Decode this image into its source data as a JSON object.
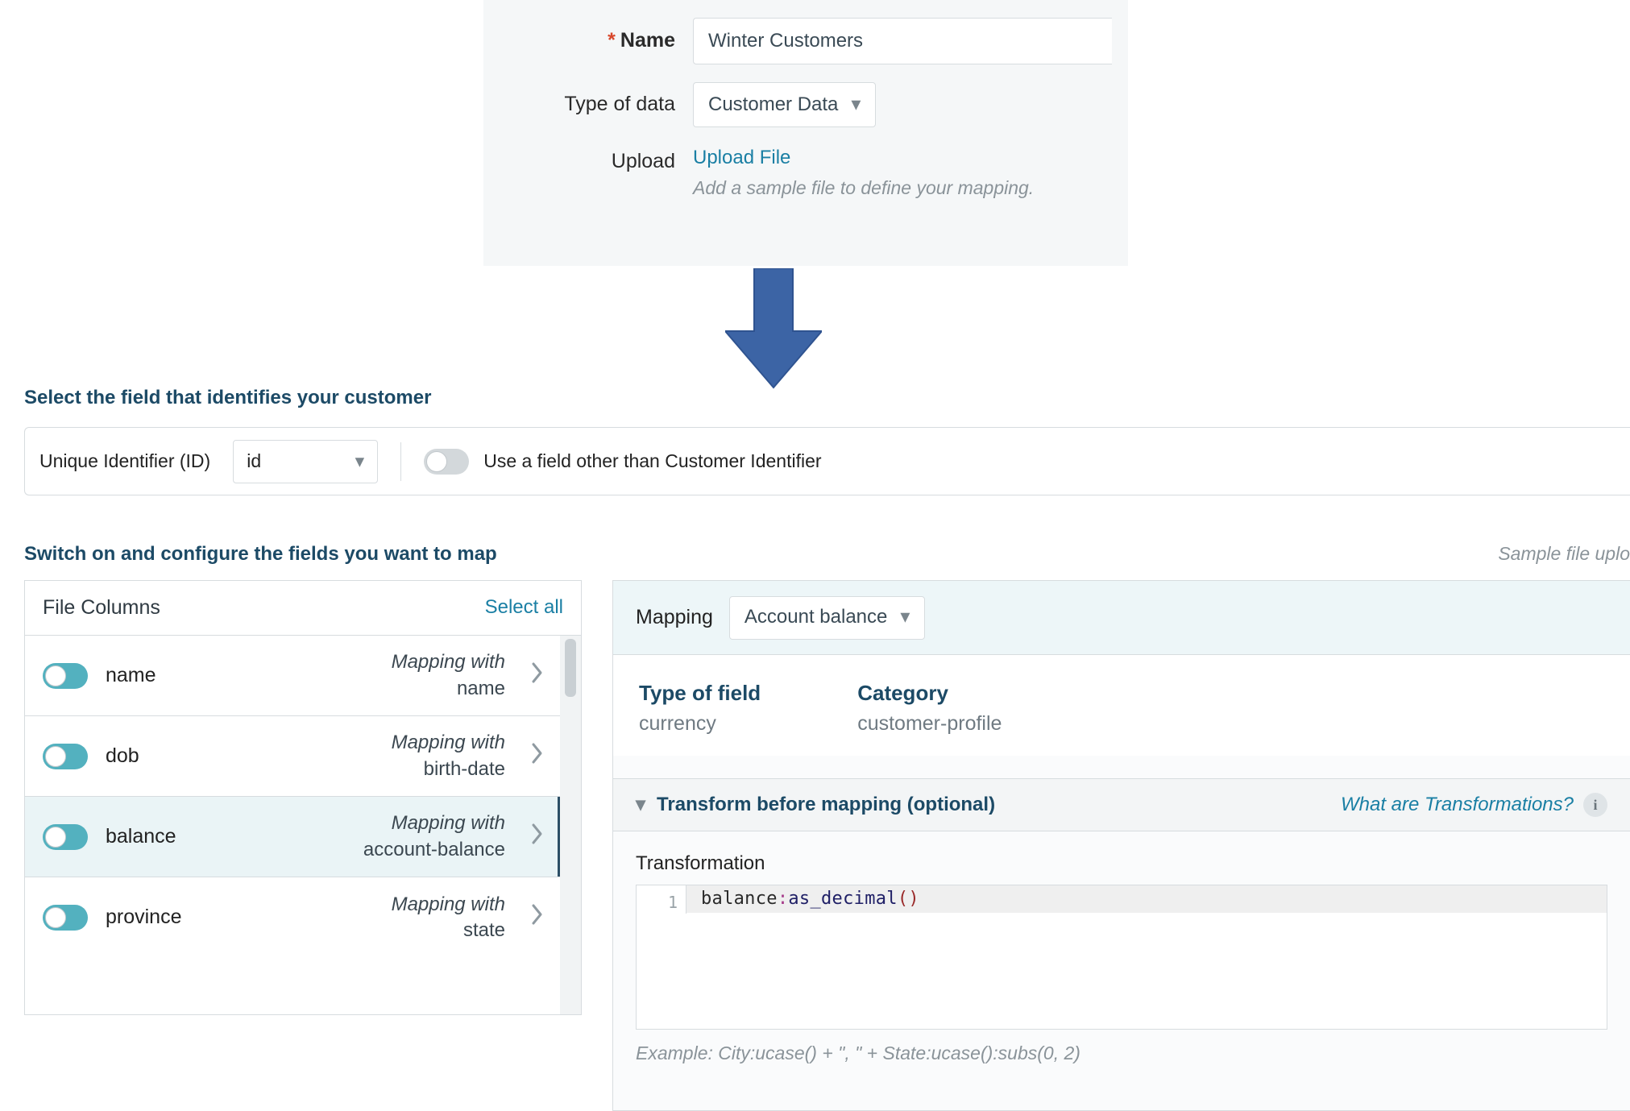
{
  "form": {
    "name_label": "Name",
    "name_value": "Winter Customers",
    "typeofdata_label": "Type of data",
    "typeofdata_value": "Customer Data",
    "upload_label": "Upload",
    "upload_link": "Upload File",
    "upload_hint": "Add a sample file to define your mapping."
  },
  "sections": {
    "identifier_title": "Select the field that identifies your customer",
    "map_fields_title": "Switch on and configure the fields you want to map",
    "sample_note": "Sample file uplo"
  },
  "identifier": {
    "label": "Unique Identifier (ID)",
    "selected": "id",
    "other_label": "Use a field other than Customer Identifier",
    "other_enabled": false
  },
  "columns": {
    "header": "File Columns",
    "select_all": "Select all",
    "mapping_with": "Mapping with",
    "items": [
      {
        "name": "name",
        "mapped_to": "name",
        "selected": false,
        "enabled": true
      },
      {
        "name": "dob",
        "mapped_to": "birth-date",
        "selected": false,
        "enabled": true
      },
      {
        "name": "balance",
        "mapped_to": "account-balance",
        "selected": true,
        "enabled": true
      },
      {
        "name": "province",
        "mapped_to": "state",
        "selected": false,
        "enabled": true
      }
    ]
  },
  "mapping": {
    "label": "Mapping",
    "selected": "Account balance",
    "type_label": "Type of field",
    "type_value": "currency",
    "category_label": "Category",
    "category_value": "customer-profile"
  },
  "transform": {
    "title": "Transform before mapping (optional)",
    "help_label": "What are Transformations?",
    "editor_label": "Transformation",
    "line_no": "1",
    "code_var": "balance",
    "code_colon": ":",
    "code_fn": "as_decimal",
    "code_par_open": "(",
    "code_par_close": ")",
    "example": "Example: City:ucase() + \", \" + State:ucase():subs(0, 2)"
  }
}
